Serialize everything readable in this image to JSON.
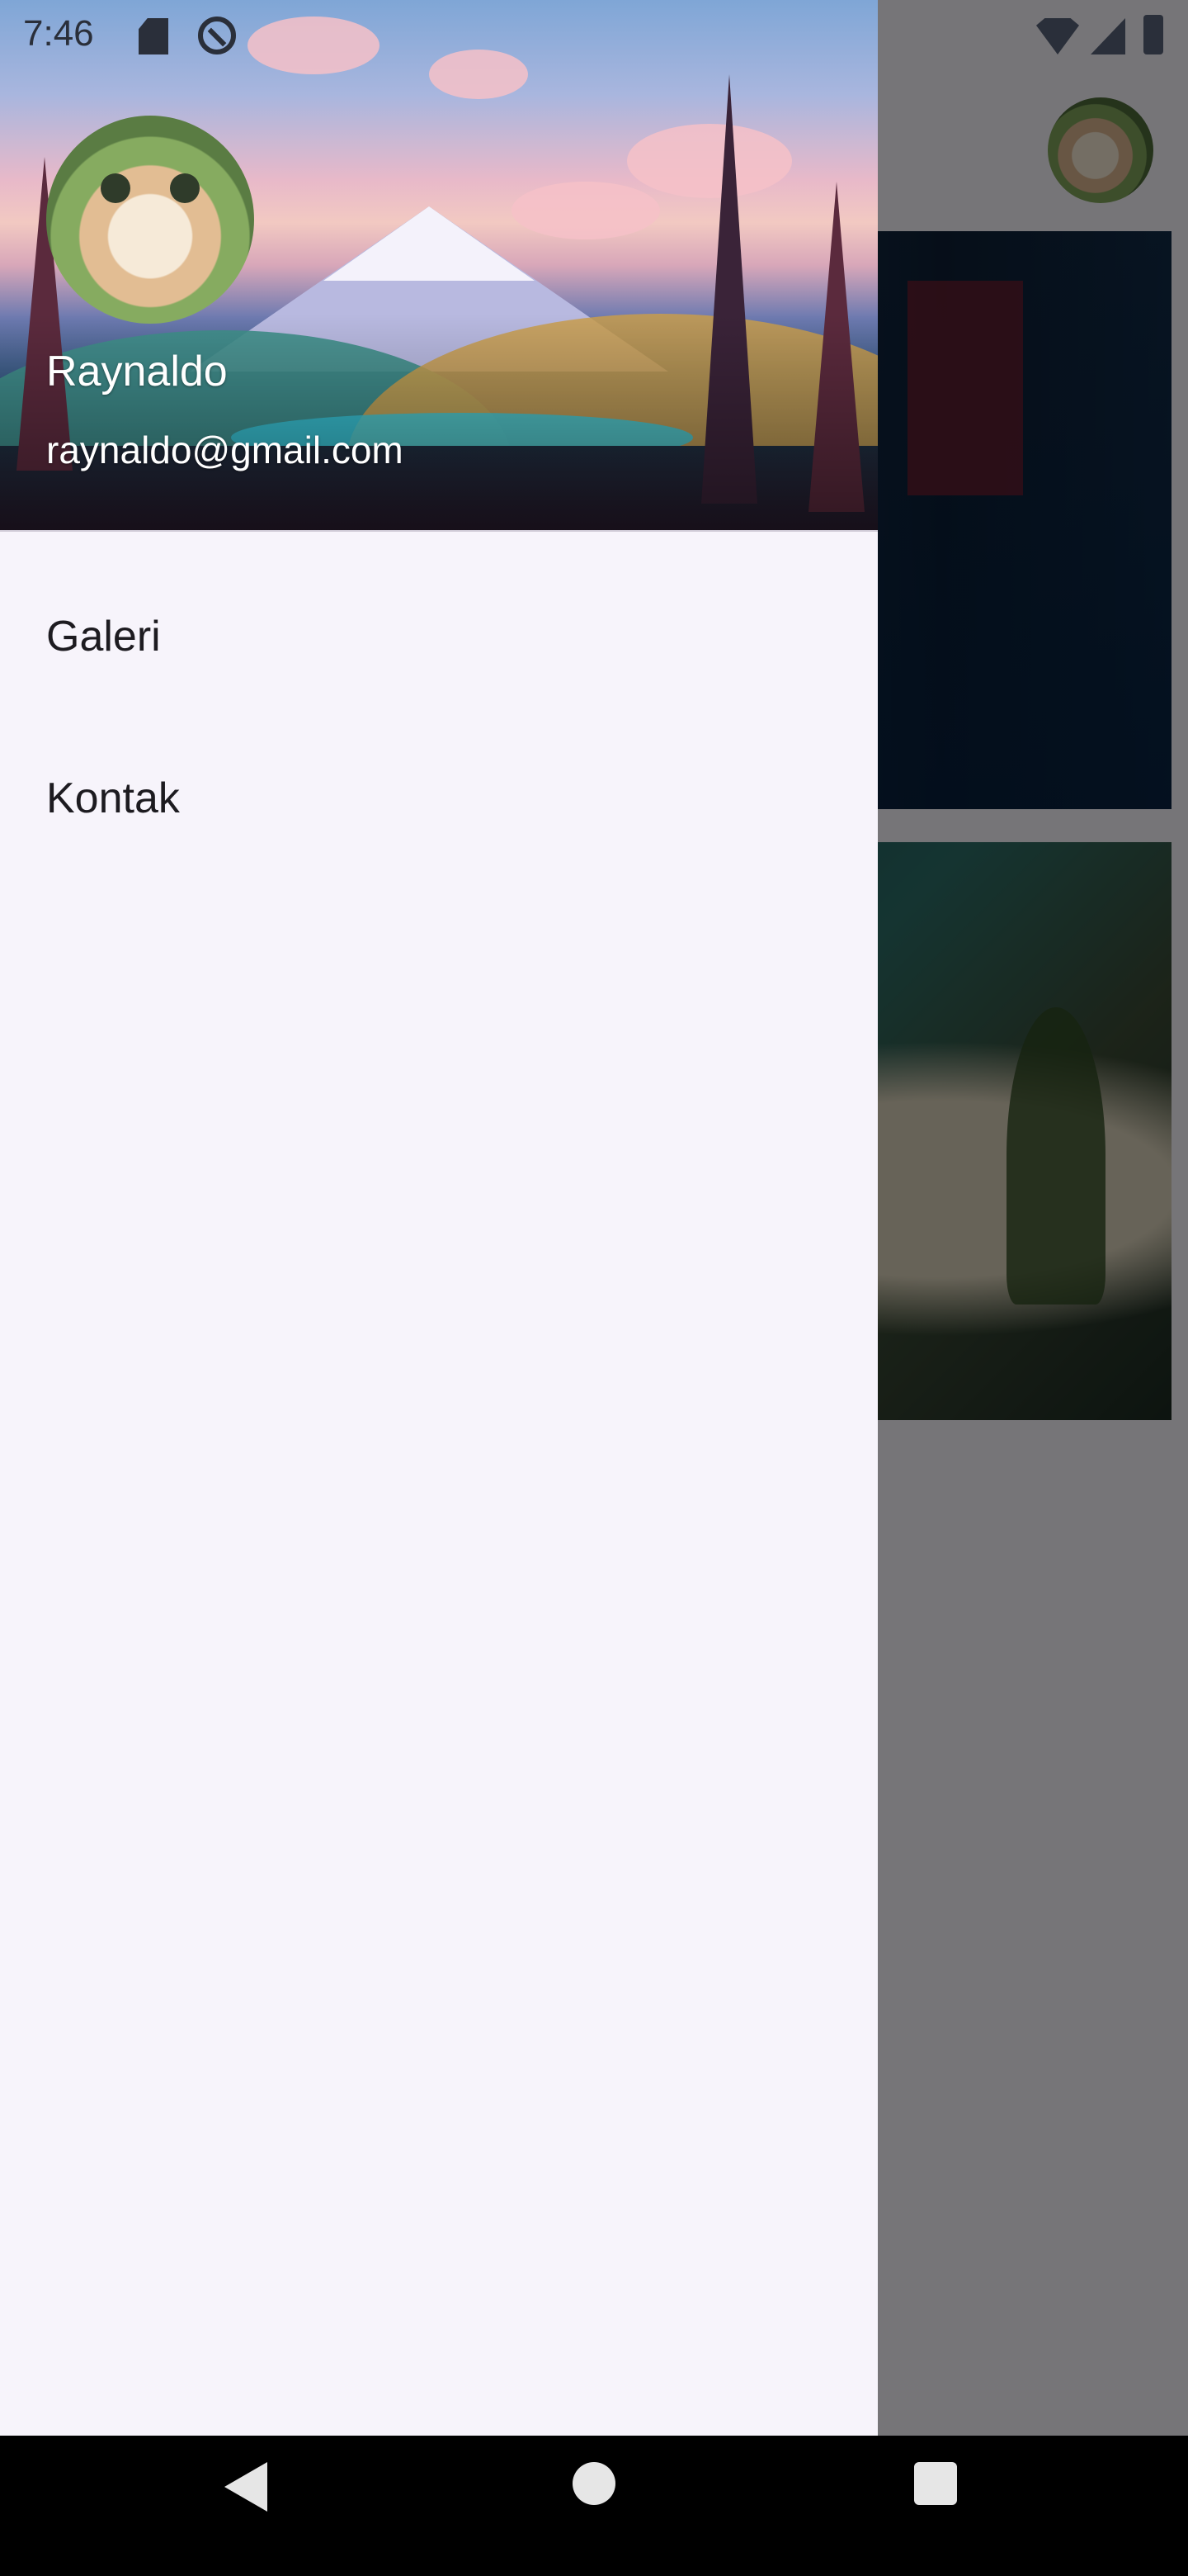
{
  "status_bar": {
    "time": "7:46",
    "icons": [
      "sd-card-icon",
      "do-not-disturb-icon",
      "wifi-icon",
      "cell-signal-icon",
      "battery-icon"
    ]
  },
  "app": {
    "avatar_icon": "profile-avatar-icon",
    "gallery": [
      "city-photo",
      "beach-photo"
    ]
  },
  "drawer": {
    "header": {
      "name": "Raynaldo",
      "email": "raynaldo@gmail.com",
      "avatar_icon": "cat-avatar-icon",
      "background": "mountain-landscape-image"
    },
    "items": [
      {
        "label": "Galeri"
      },
      {
        "label": "Kontak"
      }
    ],
    "background_color": "#f7f4fb",
    "scrim_color": "#000000"
  },
  "nav_bar": {
    "buttons": [
      "back-icon",
      "home-icon",
      "recents-icon"
    ]
  }
}
